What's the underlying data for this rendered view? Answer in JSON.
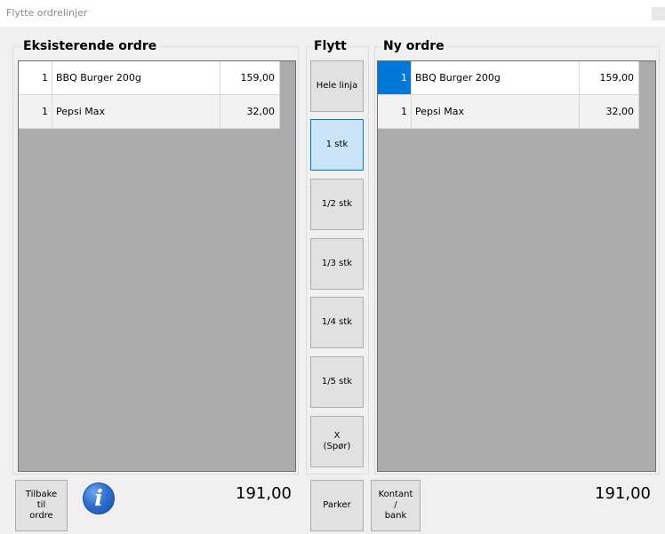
{
  "window": {
    "title": "Flytte ordrelinjer"
  },
  "existing": {
    "title": "Eksisterende ordre",
    "rows": [
      {
        "qty": "1",
        "name": "BBQ Burger 200g",
        "price": "159,00"
      },
      {
        "qty": "1",
        "name": "Pepsi Max",
        "price": "32,00"
      }
    ],
    "total": "191,00"
  },
  "move": {
    "title": "Flytt",
    "buttons": [
      "Hele linja",
      "1 stk",
      "1/2 stk",
      "1/3 stk",
      "1/4 stk",
      "1/5 stk",
      "X\n(Spør)"
    ],
    "active_button": "1 stk"
  },
  "new": {
    "title": "Ny ordre",
    "rows": [
      {
        "qty": "1",
        "name": "BBQ Burger 200g",
        "price": "159,00"
      },
      {
        "qty": "1",
        "name": "Pepsi Max",
        "price": "32,00"
      }
    ],
    "total": "191,00"
  },
  "footer": {
    "back_label": "Tilbake\ntil\nordre",
    "info_glyph": "i",
    "park_label": "Parker",
    "cash_label": "Kontant\n/\nbank"
  },
  "colors": {
    "selection": "#0078d7",
    "active_button": "#cce4f7",
    "grid_bg": "#ababab"
  }
}
